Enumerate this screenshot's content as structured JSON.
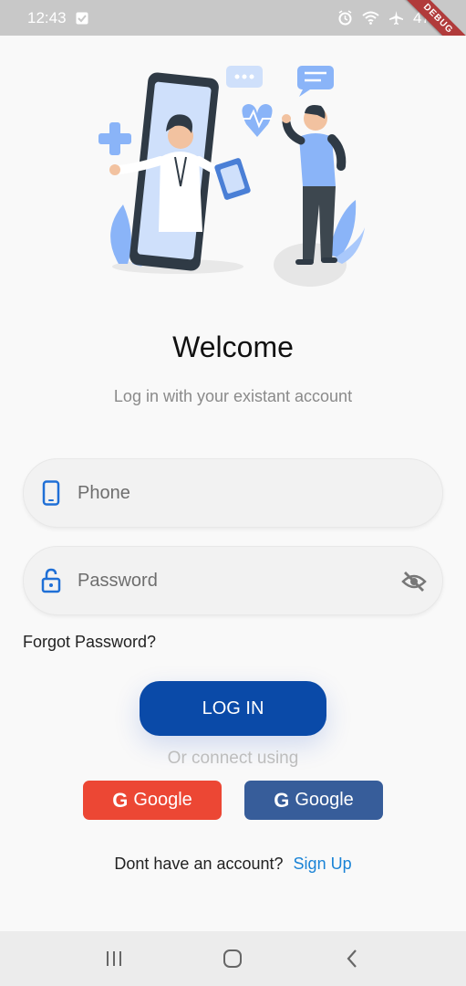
{
  "status_bar": {
    "time": "12:43",
    "battery": "47%",
    "debug_banner": "DEBUG"
  },
  "illustration": {
    "name": "doctor-telemedicine-illustration",
    "colors": {
      "accent": "#8ab4f8",
      "dark": "#2f3a45",
      "skin": "#f2c2a0"
    }
  },
  "welcome": {
    "title": "Welcome",
    "subtitle": "Log in with your existant account"
  },
  "form": {
    "phone_placeholder": "Phone",
    "password_placeholder": "Password",
    "forgot_password": "Forgot Password?",
    "login_label": "LOG IN"
  },
  "social": {
    "connect_text": "Or connect using",
    "buttons": [
      {
        "label": "Google",
        "color": "#ec4734"
      },
      {
        "label": "Google",
        "color": "#375d9a"
      }
    ]
  },
  "signup": {
    "prompt": "Dont have an account?",
    "link": "Sign Up"
  },
  "colors": {
    "primary": "#0a4aa8",
    "link": "#1a83d6",
    "icon_blue": "#1f6fd6"
  }
}
